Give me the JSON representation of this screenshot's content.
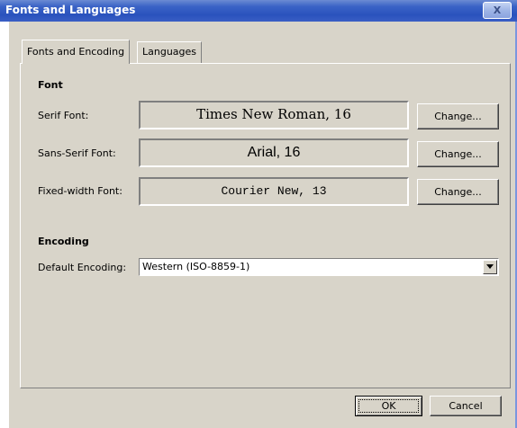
{
  "window": {
    "title": "Fonts and Languages",
    "close_glyph": "X"
  },
  "tabs": [
    {
      "label": "Fonts and Encoding",
      "active": true
    },
    {
      "label": "Languages",
      "active": false
    }
  ],
  "font_section": {
    "title": "Font",
    "rows": [
      {
        "label": "Serif Font:",
        "value": "Times New Roman, 16",
        "button": "Change..."
      },
      {
        "label": "Sans-Serif Font:",
        "value": "Arial, 16",
        "button": "Change..."
      },
      {
        "label": "Fixed-width Font:",
        "value": "Courier New, 13",
        "button": "Change..."
      }
    ]
  },
  "encoding_section": {
    "title": "Encoding",
    "label": "Default Encoding:",
    "selected": "Western (ISO-8859-1)"
  },
  "footer": {
    "ok_label": "OK",
    "cancel_label": "Cancel"
  },
  "icons": {
    "close": "close-icon",
    "dropdown": "chevron-down-icon"
  },
  "colors": {
    "titlebar": "#2a52bd",
    "dialog_face": "#d8d4c9"
  }
}
